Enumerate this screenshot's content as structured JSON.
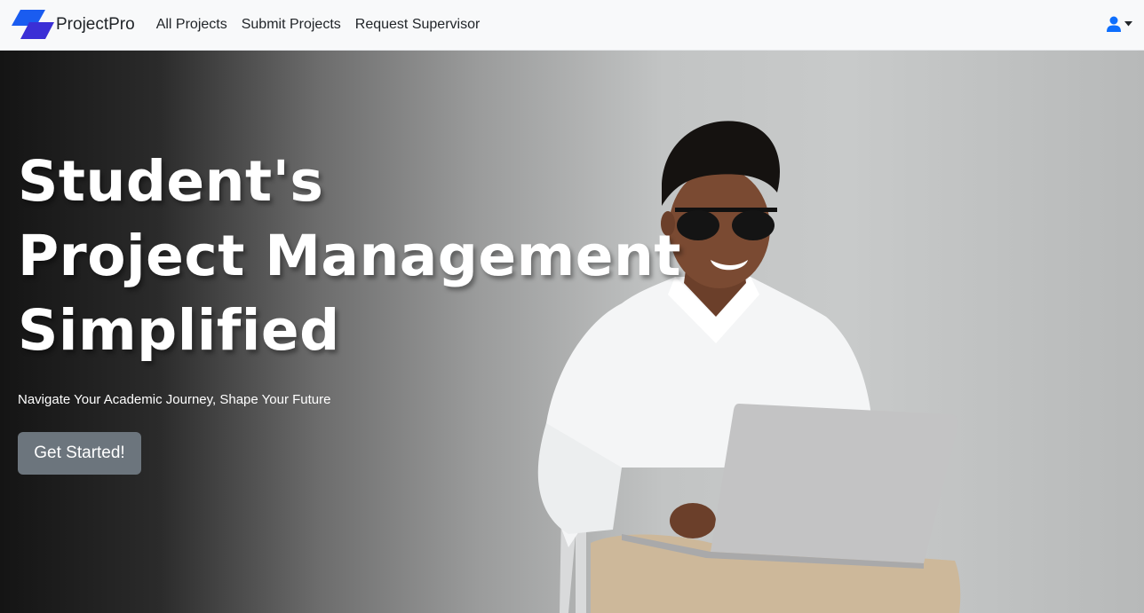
{
  "brand": {
    "name": "ProjectPro",
    "logo_icon": "parallelogram-logo-icon"
  },
  "nav": {
    "links": [
      {
        "label": "All Projects"
      },
      {
        "label": "Submit Projects"
      },
      {
        "label": "Request Supervisor"
      }
    ],
    "user_icon": "user-icon",
    "dropdown_icon": "caret-down-icon"
  },
  "hero": {
    "title_lines": [
      "Student's",
      "Project Management",
      "Simplified"
    ],
    "subtitle": "Navigate Your Academic Journey, Shape Your Future",
    "cta_label": "Get Started!"
  },
  "colors": {
    "navbar_bg": "#f8f9fa",
    "logo_blue": "#1a5cf0",
    "logo_indigo": "#3b2fd6",
    "user_icon": "#0d6efd",
    "cta_bg": "#6c757d"
  }
}
